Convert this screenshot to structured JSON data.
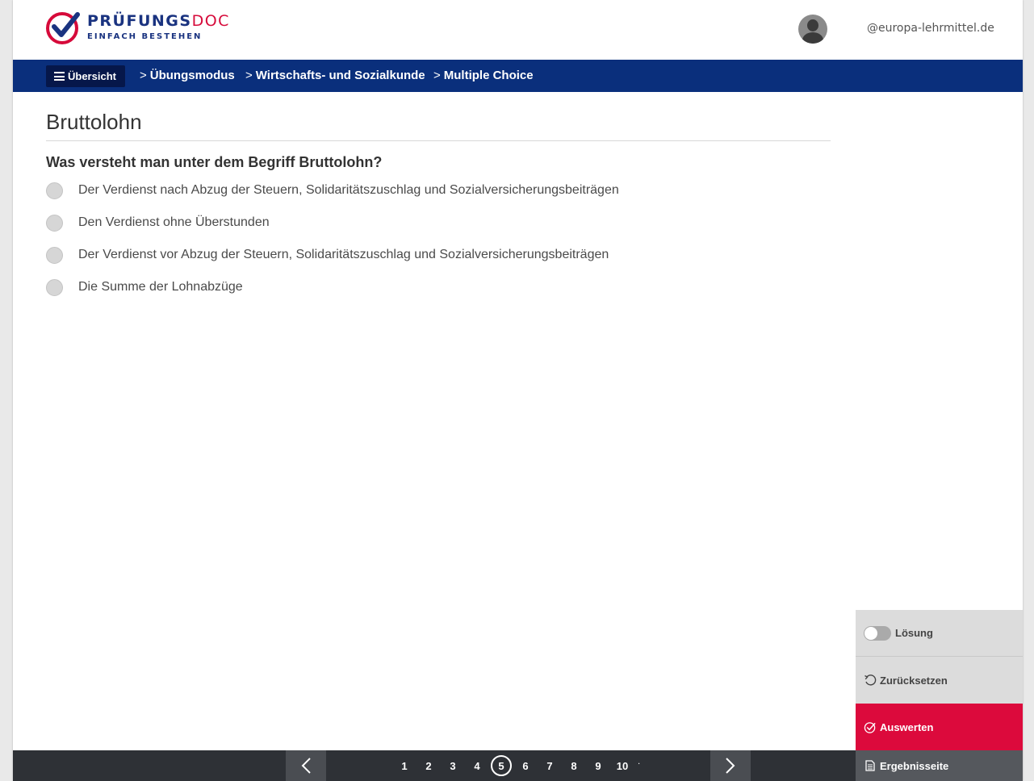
{
  "header": {
    "logo_name_main": "PRÜFUNGS",
    "logo_name_accent": "DOC",
    "logo_tagline": "EINFACH BESTEHEN",
    "user_email": "@europa-lehrmittel.de"
  },
  "nav": {
    "overview_label": "Übersicht",
    "breadcrumbs": [
      "Übungsmodus",
      "Wirtschafts- und Sozialkunde",
      "Multiple Choice"
    ]
  },
  "content": {
    "title": "Bruttolohn",
    "question": "Was versteht man unter dem Begriff Bruttolohn?",
    "answers": [
      "Der Verdienst nach Abzug der Steuern, Solidaritätszuschlag und Sozialversicherungsbeiträgen",
      "Den Verdienst ohne Überstunden",
      "Der Verdienst vor Abzug der Steuern, Solidaritätszuschlag und Sozialversicherungsbeiträgen",
      "Die Summe der Lohnabzüge"
    ]
  },
  "actions": {
    "solution_label": "Lösung",
    "solution_enabled": false,
    "reset_label": "Zurücksetzen",
    "evaluate_label": "Auswerten",
    "results_label": "Ergebnisseite"
  },
  "pagination": {
    "pages": [
      "1",
      "2",
      "3",
      "4",
      "5",
      "6",
      "7",
      "8",
      "9",
      "10"
    ],
    "current_page": "5",
    "more_indicator": "·"
  },
  "colors": {
    "brand_blue": "#0a2f7c",
    "brand_red": "#dc0a3c",
    "overview_button": "#06174a",
    "bottom_bar": "#2e3136"
  },
  "icons": {
    "overview": "hamburger-icon",
    "breadcrumb": "chevron-right-icon",
    "avatar": "user-avatar-icon",
    "reset": "undo-icon",
    "evaluate": "check-circle-icon",
    "results": "document-icon",
    "prev": "chevron-left-icon",
    "next": "chevron-right-icon"
  }
}
